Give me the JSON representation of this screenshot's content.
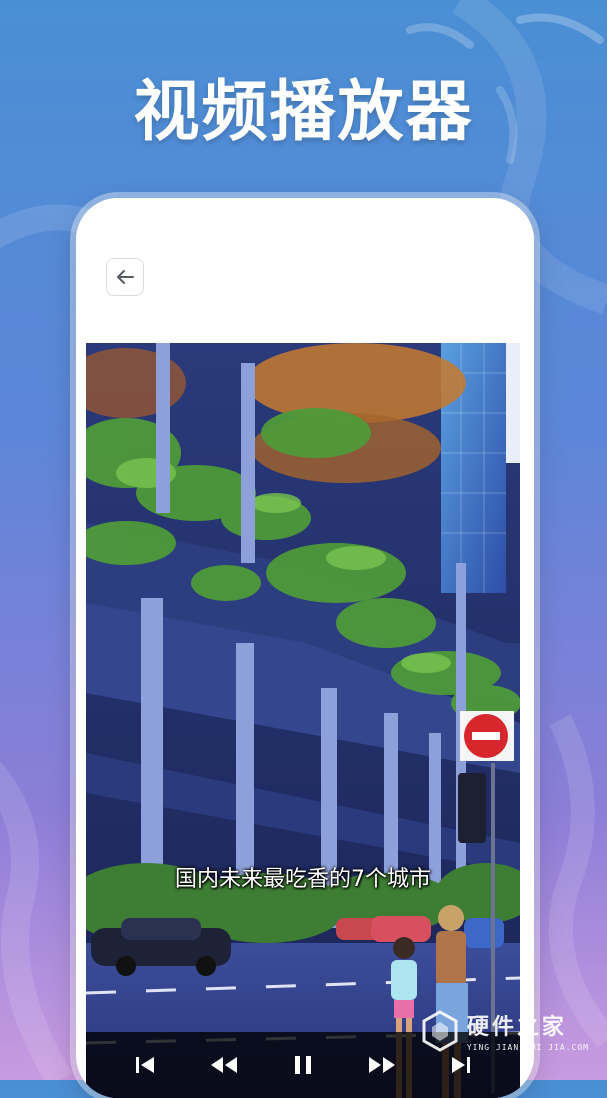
{
  "headline": "视频播放器",
  "player": {
    "back_icon": "back-arrow-icon",
    "subtitle": "国内未来最吃香的7个城市",
    "controls": [
      {
        "name": "skip-previous",
        "icon": "skip-previous-icon"
      },
      {
        "name": "rewind",
        "icon": "rewind-icon"
      },
      {
        "name": "pause",
        "icon": "pause-icon"
      },
      {
        "name": "fast-forward",
        "icon": "fast-forward-icon"
      },
      {
        "name": "skip-next",
        "icon": "skip-next-icon"
      }
    ]
  },
  "watermark": {
    "title": "硬件之家",
    "subtitle": "YING JIAN ZHI JIA.COM"
  },
  "colors": {
    "background_top": "#4a8fd4",
    "background_bottom": "#c99be0",
    "card": "#ffffff",
    "control_bar": "#000000"
  }
}
